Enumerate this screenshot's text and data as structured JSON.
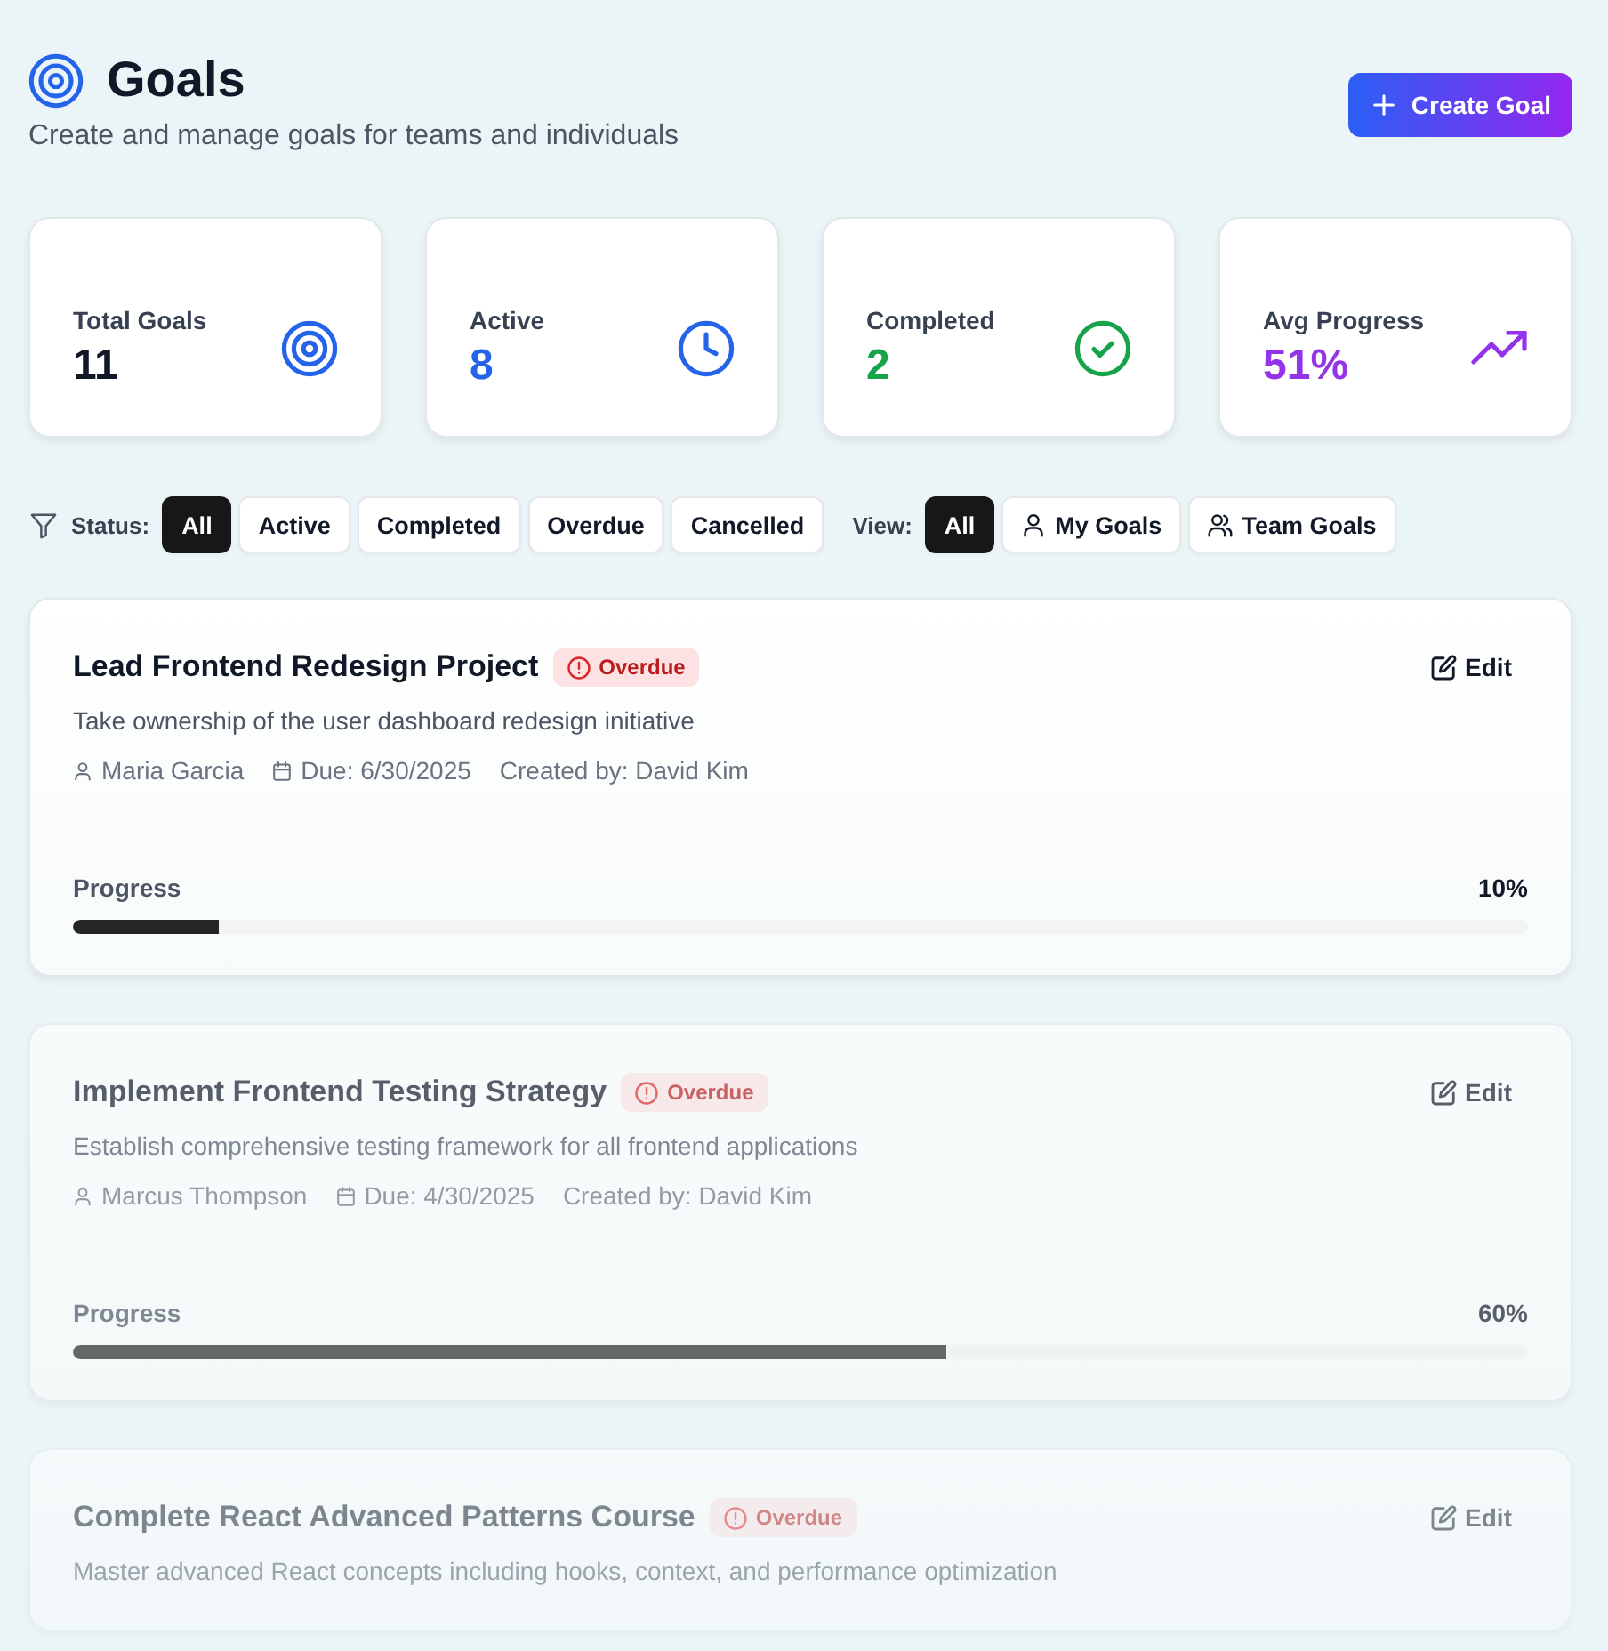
{
  "header": {
    "title": "Goals",
    "subtitle": "Create and manage goals for teams and individuals",
    "create_button": "Create Goal"
  },
  "stats": [
    {
      "label": "Total Goals",
      "value": "11",
      "kind": "target",
      "color": "#111827"
    },
    {
      "label": "Active",
      "value": "8",
      "kind": "clock",
      "color": "#2563eb"
    },
    {
      "label": "Completed",
      "value": "2",
      "kind": "check",
      "color": "#16a34a"
    },
    {
      "label": "Avg Progress",
      "value": "51%",
      "kind": "trend",
      "color": "#9333ea"
    }
  ],
  "filters": {
    "status_label": "Status:",
    "status_options": [
      {
        "label": "All",
        "selected": true
      },
      {
        "label": "Active",
        "selected": false
      },
      {
        "label": "Completed",
        "selected": false
      },
      {
        "label": "Overdue",
        "selected": false
      },
      {
        "label": "Cancelled",
        "selected": false
      }
    ],
    "view_label": "View:",
    "view_options": [
      {
        "label": "All",
        "selected": true,
        "kind": "plain"
      },
      {
        "label": "My Goals",
        "selected": false,
        "kind": "user"
      },
      {
        "label": "Team Goals",
        "selected": false,
        "kind": "team"
      }
    ]
  },
  "goals": [
    {
      "kind": "full",
      "title": "Lead Frontend Redesign Project",
      "status": {
        "label": "Overdue",
        "kind": "overdue"
      },
      "edit": "Edit",
      "description": "Take ownership of the user dashboard redesign initiative",
      "owner": "Maria Garcia",
      "due": "Due: 6/30/2025",
      "created_by": "Created by: David Kim",
      "progress_label": "Progress",
      "progress_text": "10%",
      "level": 0.1
    },
    {
      "kind": "dimmed",
      "title": "Implement Frontend Testing Strategy",
      "status": {
        "label": "Overdue",
        "kind": "overdue"
      },
      "edit": "Edit",
      "description": "Establish comprehensive testing framework for all frontend applications",
      "owner": "Marcus Thompson",
      "due": "Due: 4/30/2025",
      "created_by": "Created by: David Kim",
      "progress_label": "Progress",
      "progress_text": "60%",
      "level": 0.6
    },
    {
      "kind": "faint",
      "title": "Complete React Advanced Patterns Course",
      "status": {
        "label": "Overdue",
        "kind": "overdue"
      },
      "edit": "Edit",
      "description": "Master advanced React concepts including hooks, context, and performance optimization"
    }
  ]
}
